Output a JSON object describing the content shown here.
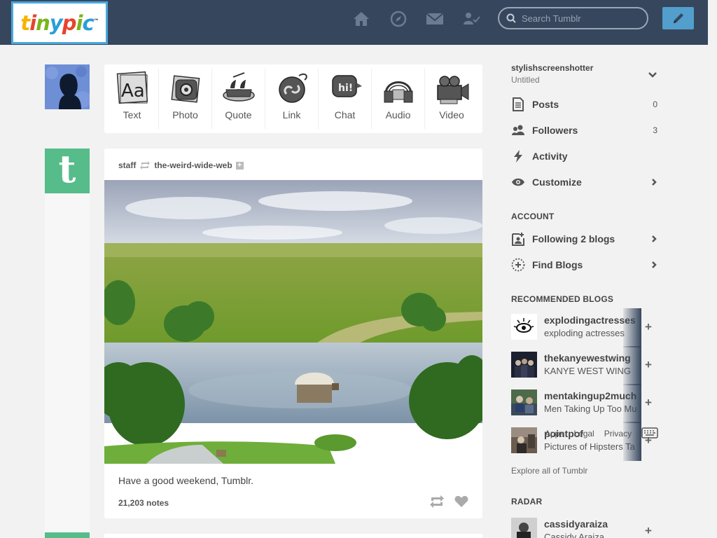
{
  "header": {
    "logo_text": "tinypic",
    "logo_tm": "™",
    "search_placeholder": "Search Tumblr",
    "nav_icons": [
      "home-icon",
      "compass-icon",
      "mail-icon",
      "activity-user-icon"
    ],
    "compose_icon": "pencil-icon"
  },
  "post_types": [
    {
      "label": "Text",
      "icon": "text-icon"
    },
    {
      "label": "Photo",
      "icon": "camera-icon"
    },
    {
      "label": "Quote",
      "icon": "quote-icon"
    },
    {
      "label": "Link",
      "icon": "link-icon"
    },
    {
      "label": "Chat",
      "icon": "chat-icon"
    },
    {
      "label": "Audio",
      "icon": "headphones-icon"
    },
    {
      "label": "Video",
      "icon": "video-camera-icon"
    }
  ],
  "post": {
    "author": "staff",
    "reblogged_from": "the-weird-wide-web",
    "follow_plus": "+",
    "caption": "Have a good weekend, Tumblr.",
    "notes": "21,203 notes",
    "avatar_letter": "t"
  },
  "sidebar": {
    "blog_name": "stylishscreenshotter",
    "blog_subtitle": "Untitled",
    "menu": [
      {
        "label": "Posts",
        "count": "0",
        "icon": "document-icon"
      },
      {
        "label": "Followers",
        "count": "3",
        "icon": "users-icon"
      },
      {
        "label": "Activity",
        "count": "",
        "icon": "lightning-icon"
      },
      {
        "label": "Customize",
        "count": "",
        "icon": "eye-icon"
      }
    ],
    "account_title": "ACCOUNT",
    "account_items": [
      {
        "label": "Following 2 blogs",
        "icon": "add-person-icon"
      },
      {
        "label": "Find Blogs",
        "icon": "find-blogs-icon"
      }
    ],
    "recommended_title": "RECOMMENDED BLOGS",
    "recommended": [
      {
        "name": "explodingactresses",
        "title": "exploding actresses"
      },
      {
        "name": "thekanyewestwing",
        "title": "KANYE WEST WING"
      },
      {
        "name": "mentakingup2much",
        "title": "Men Taking Up Too Mu"
      },
      {
        "name": "pointpof",
        "title": "Pictures of Hipsters Ta"
      }
    ],
    "footer_links": [
      "Apps",
      "Legal",
      "Privacy"
    ],
    "explore": "Explore all of Tumblr",
    "radar_title": "RADAR",
    "radar": {
      "name": "cassidyaraiza",
      "title": "Cassidy Araiza"
    },
    "plus": "+"
  },
  "colors": {
    "header_bg": "#36465d",
    "compose_bg": "#529ecc",
    "staff_green": "#56bc8a",
    "page_bg": "#f2f2f2"
  }
}
